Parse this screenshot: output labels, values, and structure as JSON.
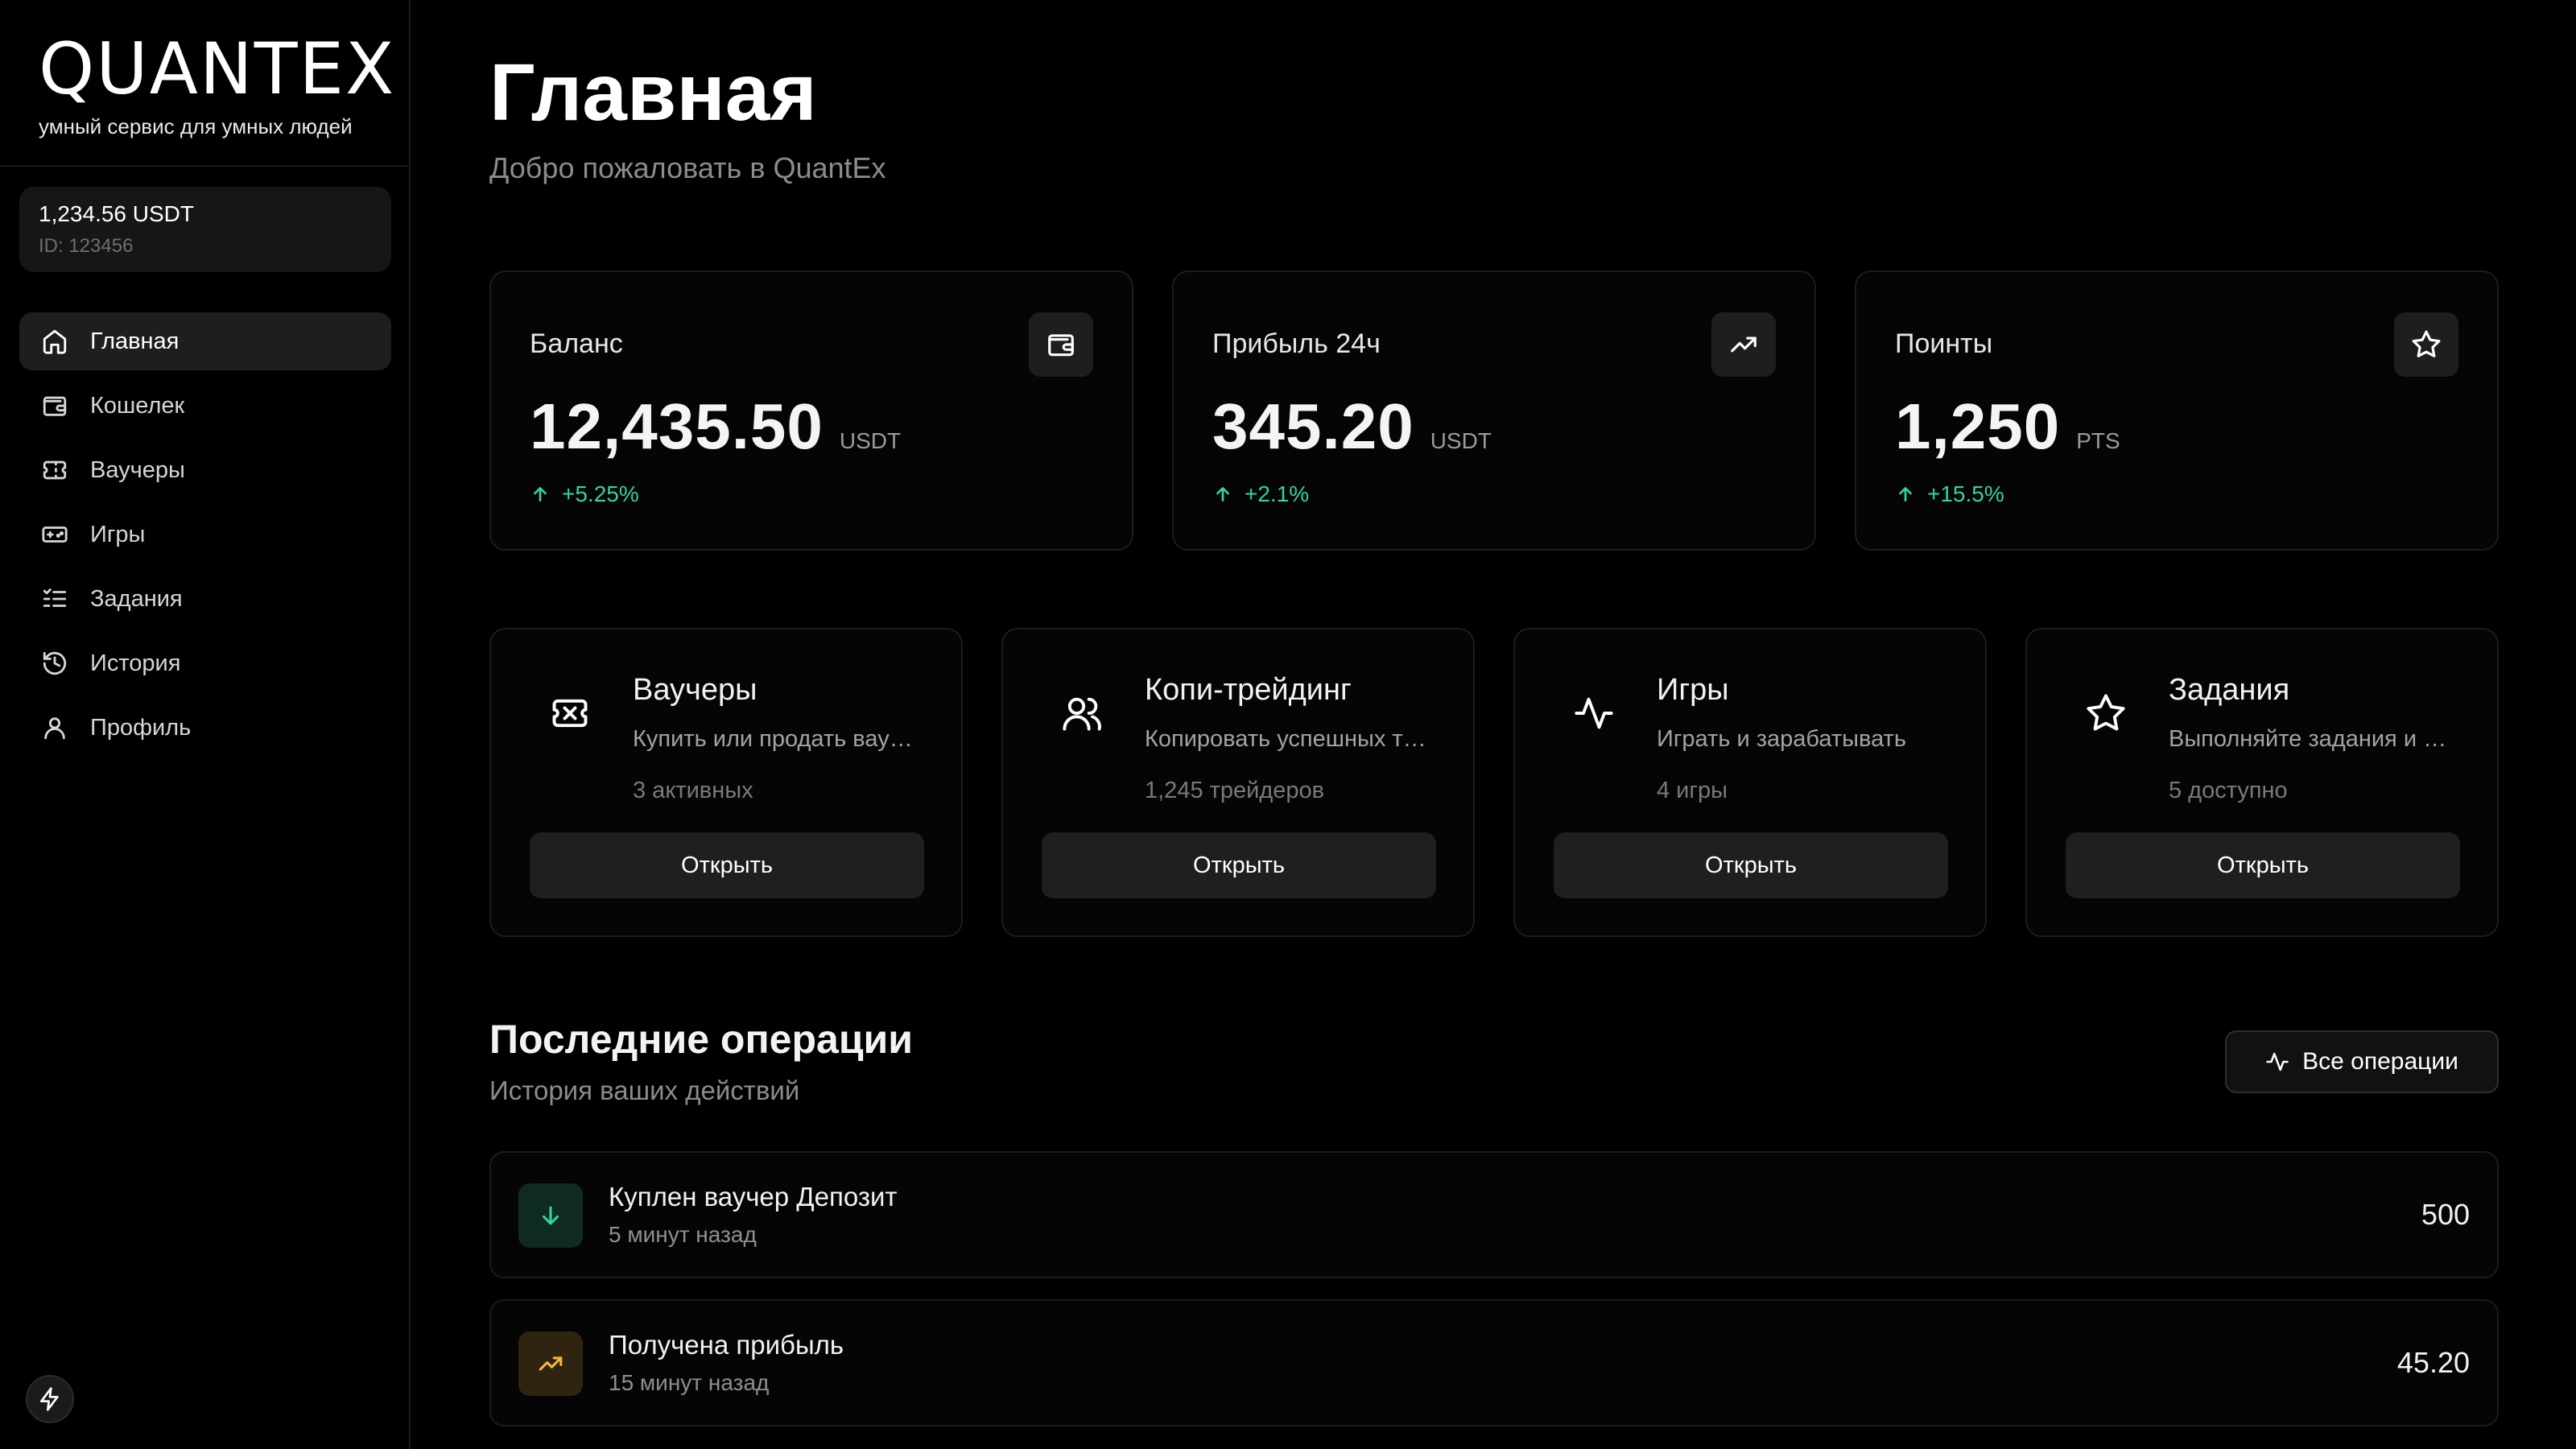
{
  "brand": {
    "logo": "QUANTEX",
    "tagline": "умный сервис для умных людей"
  },
  "account": {
    "balance": "1,234.56 USDT",
    "id": "ID: 123456"
  },
  "nav": [
    {
      "label": "Главная",
      "icon": "home-icon",
      "active": true
    },
    {
      "label": "Кошелек",
      "icon": "wallet-icon"
    },
    {
      "label": "Ваучеры",
      "icon": "ticket-icon"
    },
    {
      "label": "Игры",
      "icon": "gamepad-icon"
    },
    {
      "label": "Задания",
      "icon": "list-icon"
    },
    {
      "label": "История",
      "icon": "history-icon"
    },
    {
      "label": "Профиль",
      "icon": "user-icon"
    }
  ],
  "header": {
    "title": "Главная",
    "subtitle": "Добро пожаловать в QuantEx"
  },
  "stats": [
    {
      "label": "Баланс",
      "value": "12,435.50",
      "unit": "USDT",
      "change": "+5.25%",
      "icon": "wallet-icon"
    },
    {
      "label": "Прибыль 24ч",
      "value": "345.20",
      "unit": "USDT",
      "change": "+2.1%",
      "icon": "trending-up-icon"
    },
    {
      "label": "Поинты",
      "value": "1,250",
      "unit": "PTS",
      "change": "+15.5%",
      "icon": "star-icon"
    }
  ],
  "cards": [
    {
      "title": "Ваучеры",
      "desc": "Купить или продать ваучеры",
      "meta": "3 активных",
      "button": "Открыть",
      "icon": "ticket-icon"
    },
    {
      "title": "Копи-трейдинг",
      "desc": "Копировать успешных трейдеров",
      "meta": "1,245 трейдеров",
      "button": "Открыть",
      "icon": "users-icon"
    },
    {
      "title": "Игры",
      "desc": "Играть и зарабатывать",
      "meta": "4 игры",
      "button": "Открыть",
      "icon": "activity-icon"
    },
    {
      "title": "Задания",
      "desc": "Выполняйте задания и получайте поинты",
      "meta": "5 доступно",
      "button": "Открыть",
      "icon": "star-icon"
    }
  ],
  "operations": {
    "title": "Последние операции",
    "subtitle": "История ваших действий",
    "all_button": "Все операции",
    "items": [
      {
        "title": "Куплен ваучер Депозит",
        "time": "5 минут назад",
        "amount": "500",
        "icon": "arrow-down-icon",
        "color": "#34d399"
      },
      {
        "title": "Получена прибыль",
        "time": "15 минут назад",
        "amount": "45.20",
        "icon": "trending-up-icon",
        "color": "#f5b73b"
      }
    ]
  },
  "colors": {
    "positive": "#34d399",
    "warning": "#f5b73b",
    "background": "#000000"
  }
}
